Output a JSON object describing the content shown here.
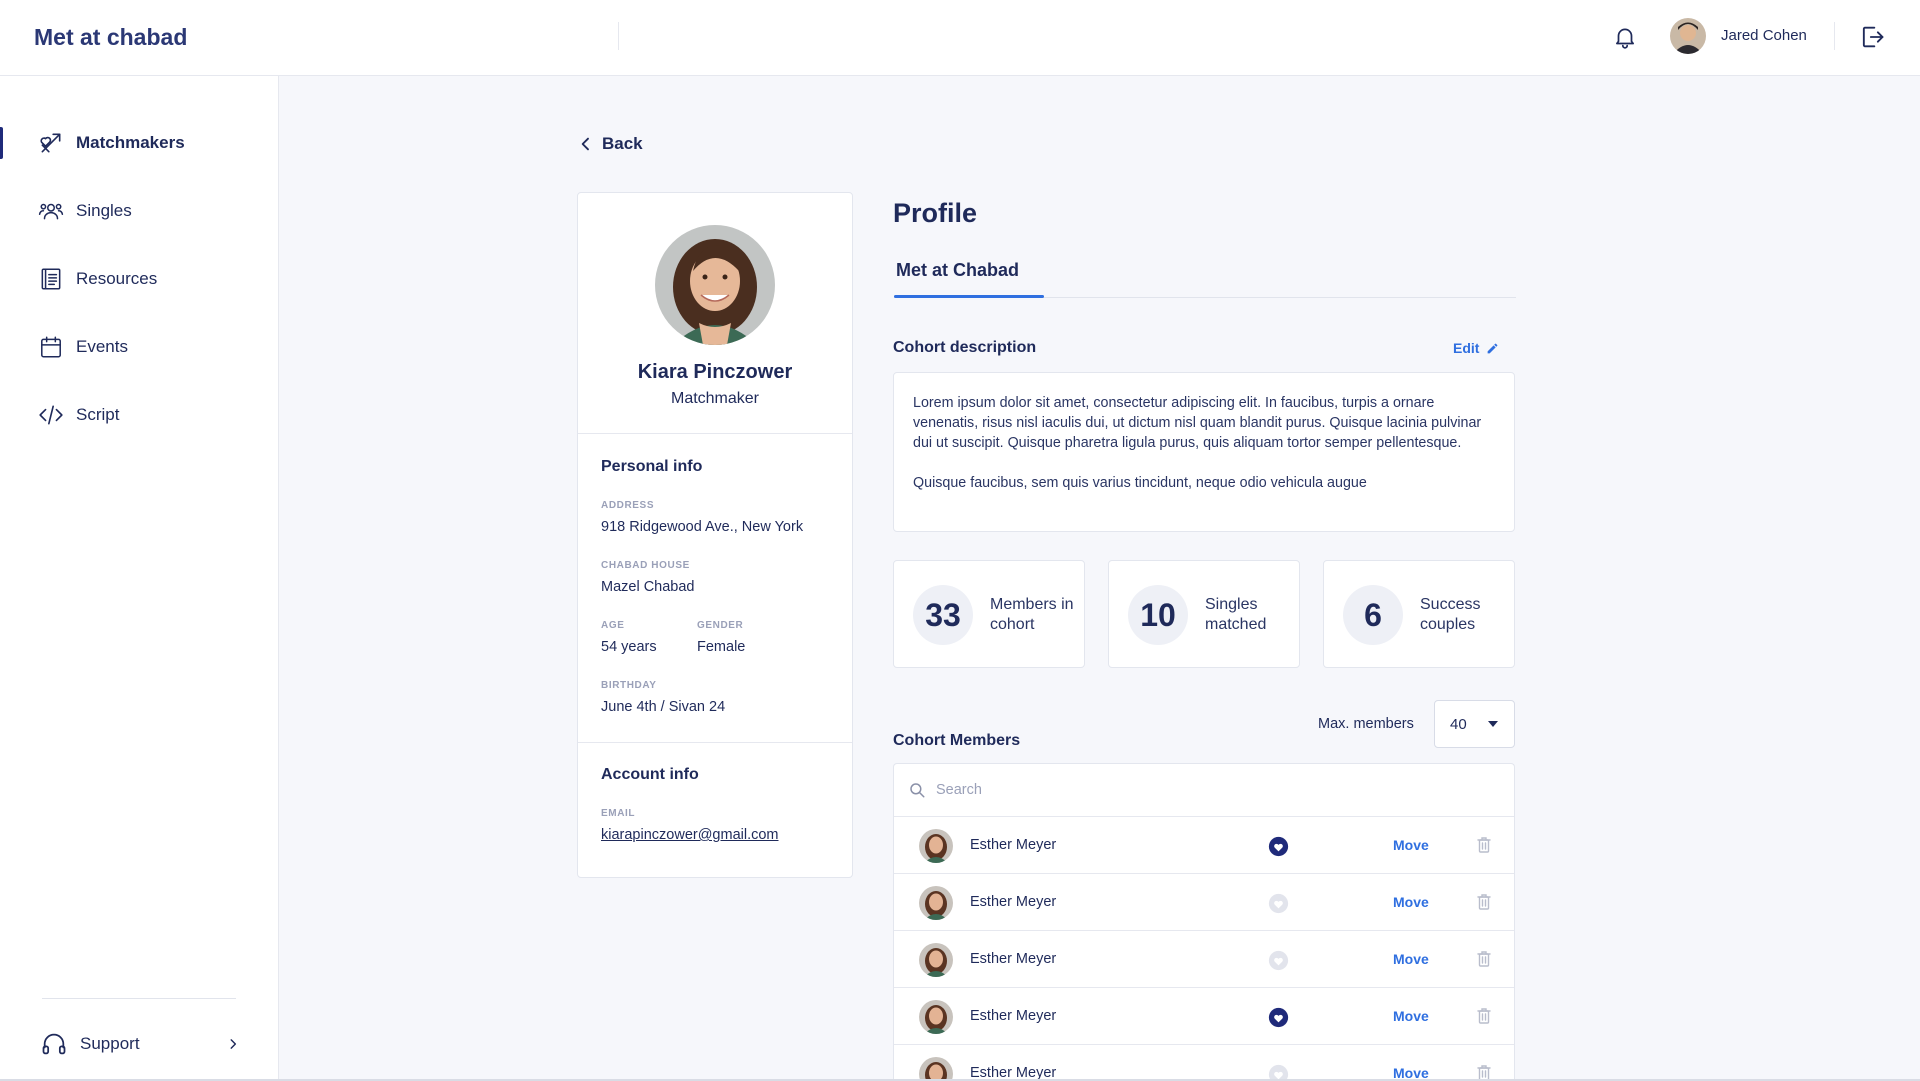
{
  "app": {
    "brand": "Met at chabad"
  },
  "user": {
    "name": "Jared Cohen"
  },
  "sidebar": {
    "items": [
      {
        "label": "Matchmakers",
        "icon": "matchmakers-icon",
        "active": true
      },
      {
        "label": "Singles",
        "icon": "singles-icon",
        "active": false
      },
      {
        "label": "Resources",
        "icon": "resources-icon",
        "active": false
      },
      {
        "label": "Events",
        "icon": "calendar-icon",
        "active": false
      },
      {
        "label": "Script",
        "icon": "code-icon",
        "active": false
      }
    ],
    "support": "Support"
  },
  "back": "Back",
  "profile_card": {
    "name": "Kiara Pinczower",
    "role": "Matchmaker",
    "personal_title": "Personal info",
    "address_label": "Address",
    "address": "918 Ridgewood Ave., New York",
    "house_label": "Chabad house",
    "house": "Mazel Chabad",
    "age_label": "Age",
    "age": "54 years",
    "gender_label": "Gender",
    "gender": "Female",
    "birthday_label": "Birthday",
    "birthday": "June 4th / Sivan 24",
    "account_title": "Account info",
    "email_label": "Email",
    "email": "kiarapinczower@gmail.com"
  },
  "main": {
    "title": "Profile",
    "tab": "Met at Chabad",
    "cohort_title": "Cohort description",
    "edit": "Edit",
    "desc_p1": "Lorem ipsum dolor sit amet, consectetur adipiscing elit. In faucibus, turpis a ornare venenatis, risus nisl iaculis dui, ut dictum nisl quam blandit purus. Quisque lacinia pulvinar dui ut suscipit. Quisque pharetra ligula purus, quis aliquam tortor semper pellentesque.",
    "desc_p2": "Quisque faucibus, sem quis varius tincidunt, neque odio vehicula augue",
    "stats": [
      {
        "value": "33",
        "label": "Members in cohort"
      },
      {
        "value": "10",
        "label": "Singles matched"
      },
      {
        "value": "6",
        "label": "Success couples"
      }
    ],
    "members_title": "Cohort Members",
    "max_label": "Max. members",
    "max_value": "40",
    "search_placeholder": "Search",
    "members": [
      {
        "name": "Esther Meyer",
        "favorite": true,
        "action": "Move"
      },
      {
        "name": "Esther Meyer",
        "favorite": false,
        "action": "Move"
      },
      {
        "name": "Esther Meyer",
        "favorite": false,
        "action": "Move"
      },
      {
        "name": "Esther Meyer",
        "favorite": true,
        "action": "Move"
      },
      {
        "name": "Esther Meyer",
        "favorite": false,
        "action": "Move"
      }
    ]
  },
  "colors": {
    "primary": "#1f2a5a",
    "accent": "#2f6fe0",
    "heart_on": "#1f2a7a",
    "heart_off": "#e2e4ec"
  }
}
